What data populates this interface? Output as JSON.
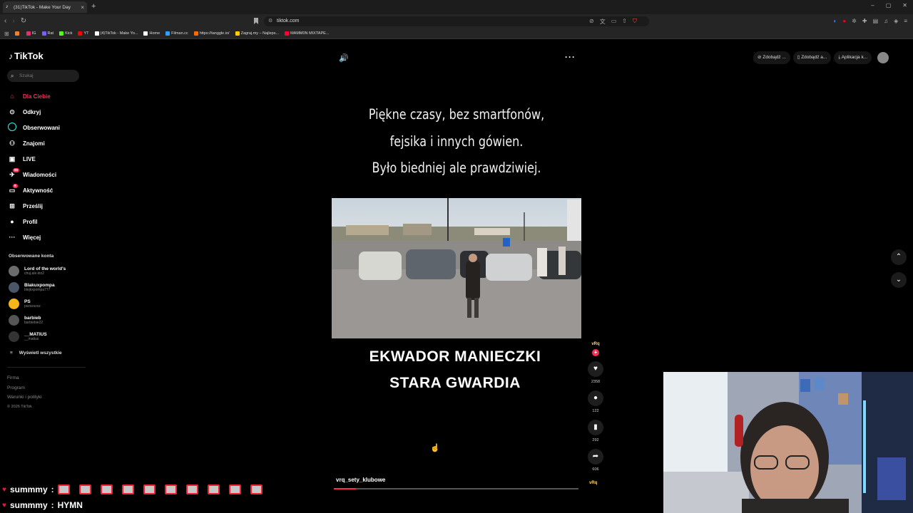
{
  "browser": {
    "tab_title": "(31)TikTok - Make Your Day",
    "tab_close": "×",
    "new_tab": "+",
    "window_controls": [
      "–",
      "▢",
      "✕"
    ],
    "url": "tiktok.com",
    "bookmarks": [
      {
        "label": "",
        "color": "#f48024"
      },
      {
        "label": "IG",
        "color": "#e1306c"
      },
      {
        "label": "Rat",
        "color": "#7b5cff"
      },
      {
        "label": "Kick",
        "color": "#53fc18"
      },
      {
        "label": "YT",
        "color": "#ff0000"
      },
      {
        "label": "(4)TikTok - Make Yo...",
        "color": "#ffffff"
      },
      {
        "label": "Home",
        "color": "#ffffff"
      },
      {
        "label": "Filman.cc",
        "color": "#2ea0ff"
      },
      {
        "label": "https://tanggle.io/",
        "color": "#ff6a00"
      },
      {
        "label": "Zagraj.my – Najleps...",
        "color": "#ffcc00"
      },
      {
        "label": "MAMM0N MIXTAPE...",
        "color": "#ff0033"
      }
    ]
  },
  "tiktok": {
    "logo_text": "TikTok",
    "search_placeholder": "Szukaj",
    "nav": [
      {
        "label": "Dla Ciebie",
        "icon": "home-icon",
        "active": true
      },
      {
        "label": "Odkryj",
        "icon": "compass-icon"
      },
      {
        "label": "Obserwowani",
        "icon": "following-icon"
      },
      {
        "label": "Znajomi",
        "icon": "friends-icon"
      },
      {
        "label": "LIVE",
        "icon": "live-icon"
      },
      {
        "label": "Wiadomości",
        "icon": "messages-icon",
        "badge": "99"
      },
      {
        "label": "Aktywność",
        "icon": "activity-icon",
        "badge": "9"
      },
      {
        "label": "Prześlij",
        "icon": "upload-icon"
      },
      {
        "label": "Profil",
        "icon": "profile-icon"
      },
      {
        "label": "Więcej",
        "icon": "more-icon"
      }
    ],
    "followed_title": "Obserwowane konta",
    "followed_accounts": [
      {
        "name": "Lord of the world's",
        "handle": "chuj.ale.kto2"
      },
      {
        "name": "Blakuxpompa",
        "handle": "blejkxpompa777"
      },
      {
        "name": "PS",
        "handle": "pszszszsz"
      },
      {
        "name": "barbieb",
        "handle": "barbiebie22"
      },
      {
        "name": "__MATIUS",
        "handle": "__matius"
      }
    ],
    "see_all": "Wyświetl wszystkie",
    "footer": [
      "Firma",
      "Program",
      "Warunki i polityki"
    ],
    "copyright": "© 2026 TikTok",
    "top_right": [
      "Zdobądź ...",
      "Zdobądź a...",
      "Aplikacja k..."
    ],
    "video": {
      "caption_lines": [
        "Piękne czasy, bez smartfonów,",
        "fejsika i innych gówien.",
        "Było biedniej ale prawdziwiej."
      ],
      "title_lines": [
        "EKWADOR MANIECZKI",
        "STARA GWARDIA"
      ],
      "author": "vrq_sety_klubowe",
      "author_avatar_text": "vRq",
      "likes": "2358",
      "comments": "122",
      "saves": "292",
      "shares": "606",
      "progress": 0.09
    }
  },
  "chat": [
    {
      "user": "summmy",
      "sep": ":",
      "message": "",
      "emote_count": 10
    },
    {
      "user": "summmy",
      "sep": ":",
      "message": "HYMN",
      "emote_count": 0
    }
  ]
}
